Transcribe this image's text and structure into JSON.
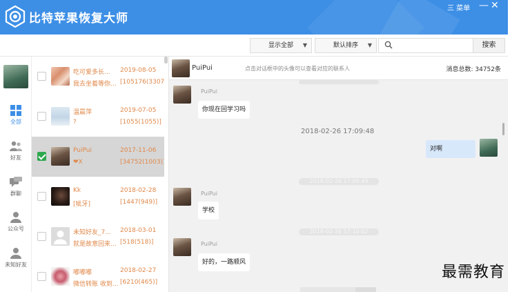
{
  "app": {
    "title": "比特苹果恢复大师",
    "menu_label": "三 菜单",
    "minimize": "—",
    "close": "✕"
  },
  "toolbar": {
    "filter_label": "显示全部",
    "sort_label": "默认排序",
    "search_placeholder": "",
    "search_button": "搜索",
    "dropdown_arrow": "▼"
  },
  "nav": {
    "items": [
      {
        "label": "全部",
        "icon": "grid-icon",
        "active": true
      },
      {
        "label": "好友",
        "icon": "friends-icon"
      },
      {
        "label": "群聊",
        "icon": "group-chat-icon"
      },
      {
        "label": "公众号",
        "icon": "official-account-icon"
      },
      {
        "label": "未知好友",
        "icon": "unknown-friend-icon"
      }
    ]
  },
  "contacts": [
    {
      "name": "吃可爱多长...",
      "sub": "我去坐着等你...",
      "date": "2019-08-05",
      "count": "[105176(33076)]",
      "checked": false
    },
    {
      "name": "温晨萍",
      "sub": "?",
      "date": "2019-07-05",
      "count": "[1055(1055)]",
      "checked": false
    },
    {
      "name": "PuiPui",
      "sub": "❤X",
      "date": "2017-11-06",
      "count": "[34752(1003)]",
      "checked": true
    },
    {
      "name": "Kk",
      "sub": "[呲牙]",
      "date": "2018-02-28",
      "count": "[1447(949)]",
      "checked": false
    },
    {
      "name": "未知好友_7...",
      "sub": "就是故意回来...",
      "date": "2018-03-01",
      "count": "[518(518)]",
      "checked": false
    },
    {
      "name": "嘟嘟嘟",
      "sub": "微信转账 收到...",
      "date": "2018-02-27",
      "count": "[6210(465)]",
      "checked": false
    }
  ],
  "chat": {
    "name": "PuiPui",
    "hint": "点击对话框中的头像可以查看对应的联系人",
    "total": "消息总数: 34752条",
    "messages": [
      {
        "sender": "PuiPui",
        "text": "你现在回学习吗"
      },
      {
        "time": "2018-02-26 17:09:48"
      },
      {
        "sender": "me",
        "text": "对啊"
      },
      {
        "time": "2018-02-26 17:09:49"
      },
      {
        "sender": "PuiPui",
        "text": "学校"
      },
      {
        "time": "2018-02-26 17:10:02"
      },
      {
        "sender": "PuiPui",
        "text": "好的，一路顺风"
      }
    ]
  },
  "watermark": "最需教育"
}
